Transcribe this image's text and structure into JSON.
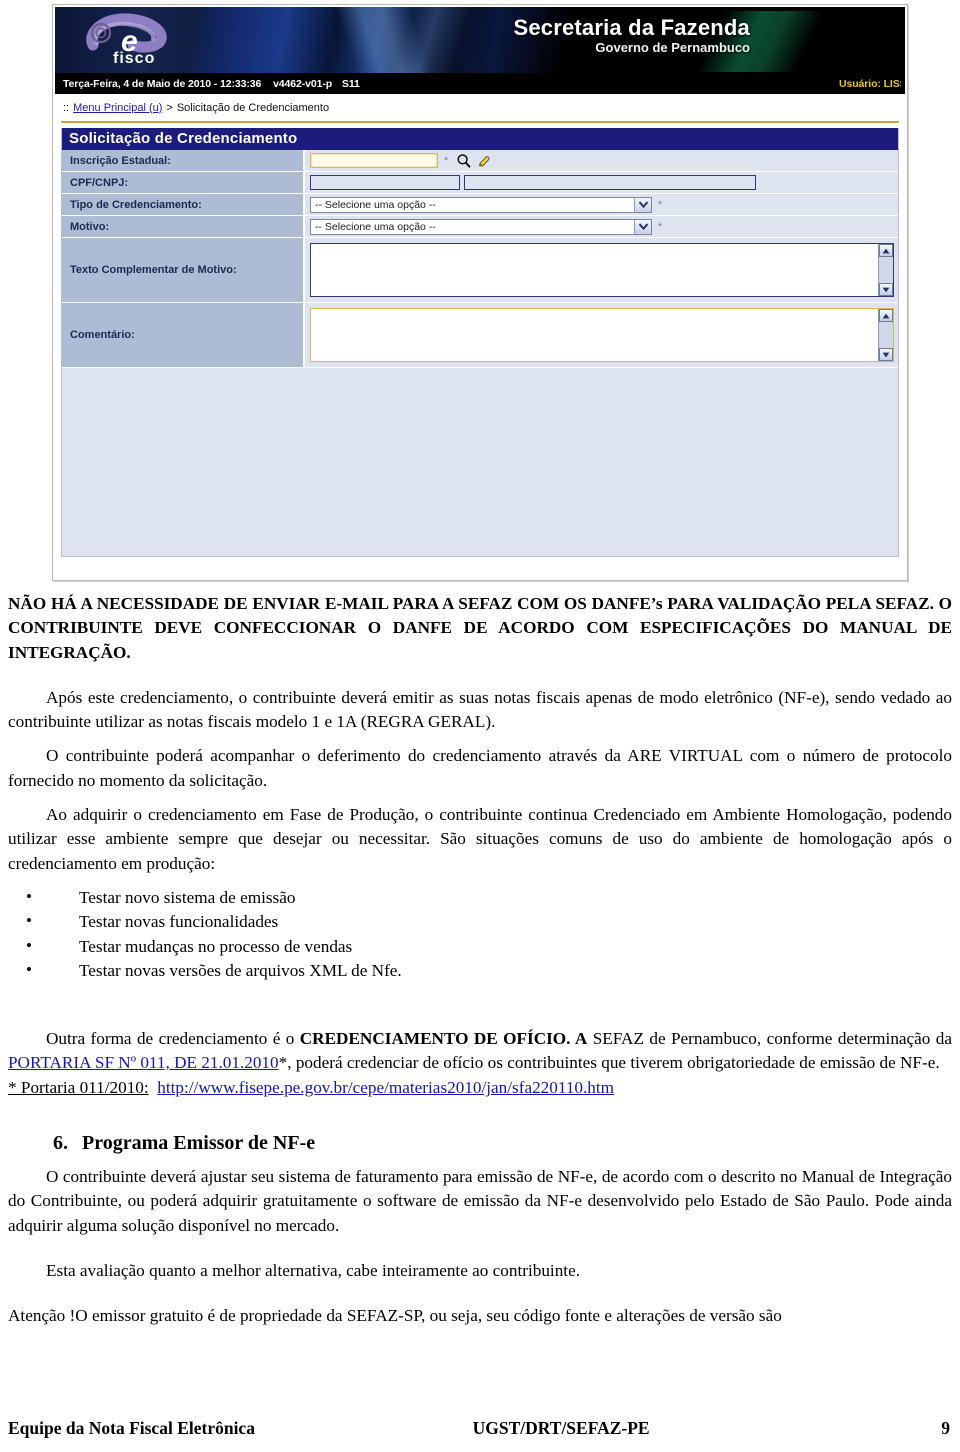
{
  "screenshot": {
    "banner": {
      "logo_alt": "e-fisco",
      "title": "Secretaria da Fazenda",
      "subtitle": "Governo de Pernambuco"
    },
    "statusbar": {
      "datetime": "Terça-Feira, 4 de Maio de 2010 - 12:33:36",
      "version": "v4462-v01-p",
      "session": "S11",
      "user": "Usuário: LISS"
    },
    "breadcrumb": {
      "prefix": "::",
      "home_link": "Menu Principal (u)",
      "separator": ">",
      "current": "Solicitação de Credenciamento"
    },
    "form": {
      "title": "Solicitação de Credenciamento",
      "required_marker": "*",
      "fields": [
        {
          "label": "Inscrição Estadual:",
          "value": "",
          "type": "text-mandatory"
        },
        {
          "label": "CPF/CNPJ:",
          "value": "",
          "value2": "",
          "type": "text-readonly"
        },
        {
          "label": "Tipo de Credenciamento:",
          "value": "-- Selecione uma opção --",
          "type": "select"
        },
        {
          "label": "Motivo:",
          "value": "-- Selecione uma opção --",
          "type": "select"
        },
        {
          "label": "Texto Complementar de Motivo:",
          "value": "",
          "type": "textarea"
        },
        {
          "label": "Comentário:",
          "value": "",
          "type": "textarea-mandatory"
        }
      ],
      "icons": [
        "search-icon",
        "eraser-icon"
      ]
    },
    "colors": {
      "panel_title_bg": "#1c1c7a",
      "label_bg": "#aebbd4",
      "panel_bg": "#dde4ef",
      "gold_rule": "#c8a63c",
      "user_text": "#e8c13a",
      "link": "#1616b0"
    }
  },
  "document": {
    "warning": "NÃO HÁ A NECESSIDADE DE ENVIAR E-MAIL PARA A SEFAZ COM OS DANFE’s PARA VALIDAÇÃO PELA SEFAZ. O CONTRIBUINTE DEVE CONFECCIONAR O DANFE DE ACORDO COM ESPECIFICAÇÕES DO MANUAL DE INTEGRAÇÃO.",
    "para1": "Após este credenciamento, o contribuinte deverá emitir as suas notas fiscais apenas de modo eletrônico (NF-e), sendo vedado ao contribuinte utilizar as notas fiscais modelo 1 e  1A  (REGRA GERAL).",
    "para2": "O contribuinte poderá acompanhar o deferimento do credenciamento através da ARE VIRTUAL com o número de protocolo fornecido no momento da solicitação.",
    "para3": "Ao adquirir o credenciamento em Fase de Produção, o contribuinte continua Credenciado em Ambiente Homologação, podendo utilizar esse ambiente sempre que desejar ou necessitar. São situações comuns de uso do ambiente de homologação após o credenciamento em produção:",
    "bullets": [
      "Testar novo sistema de emissão",
      "Testar novas funcionalidades",
      "Testar mudanças no processo de vendas",
      "Testar novas versões de arquivos XML de Nfe."
    ],
    "para4": {
      "a": "Outra forma de credenciamento é o ",
      "b_bold": "CREDENCIAMENTO DE OFÍCIO. A",
      "c": " SEFAZ de Pernambuco, conforme determinação da ",
      "d_link": "PORTARIA SF Nº 011, DE 21.01.2010",
      "e": "*, poderá credenciar de ofício os contribuintes que tiverem obrigatoriedade de emissão de NF-e."
    },
    "portaria_note": {
      "label": "* Portaria 011/2010:",
      "url": "http://www.fisepe.pe.gov.br/cepe/materias2010/jan/sfa220110.htm"
    },
    "section6": {
      "number": "6.",
      "title": "Programa Emissor de NF-e"
    },
    "para5": "O contribuinte deverá ajustar seu sistema de faturamento para emissão de NF-e, de acordo com o descrito no Manual de Integração do Contribuinte, ou poderá adquirir gratuitamente o software de emissão da NF-e desenvolvido pelo Estado de São Paulo. Pode ainda adquirir alguma solução disponível no mercado.",
    "para6": "Esta avaliação quanto a melhor alternativa, cabe inteiramente ao contribuinte.",
    "para7": "Atenção !O emissor gratuito é de propriedade da SEFAZ-SP, ou seja, seu código fonte e alterações de versão são"
  },
  "footer": {
    "left": "Equipe da Nota Fiscal Eletrônica",
    "center": "UGST/DRT/SEFAZ-PE",
    "page": "9"
  }
}
